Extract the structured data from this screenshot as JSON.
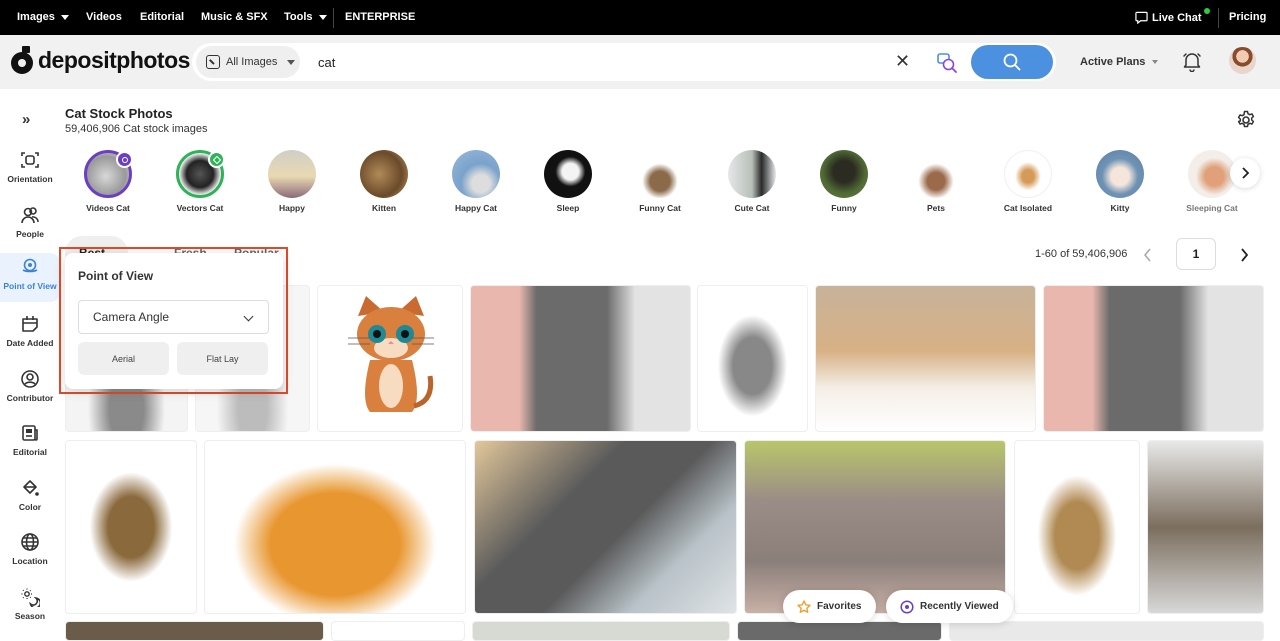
{
  "topbar": {
    "nav": [
      {
        "label": "Images",
        "has_dropdown": true
      },
      {
        "label": "Videos",
        "has_dropdown": false
      },
      {
        "label": "Editorial",
        "has_dropdown": false
      },
      {
        "label": "Music & SFX",
        "has_dropdown": false
      },
      {
        "label": "Tools",
        "has_dropdown": true
      },
      {
        "label": "ENTERPRISE",
        "has_dropdown": false
      }
    ],
    "live_chat": "Live Chat",
    "live_chat_status_color": "#2ecc40",
    "pricing": "Pricing"
  },
  "header": {
    "logo": "depositphotos",
    "search": {
      "type_select": "All Images",
      "query": "cat",
      "placeholder": ""
    },
    "search_button_color": "#4c90e0",
    "active_plans": "Active Plans"
  },
  "sidebar": {
    "toggle": "»",
    "items": [
      {
        "label": "Orientation",
        "icon": "orientation-icon",
        "active": false
      },
      {
        "label": "People",
        "icon": "people-icon",
        "active": false
      },
      {
        "label": "Point of View",
        "icon": "point-of-view-icon",
        "active": true
      },
      {
        "label": "Date Added",
        "icon": "calendar-icon",
        "active": false
      },
      {
        "label": "Contributor",
        "icon": "user-circle-icon",
        "active": false
      },
      {
        "label": "Editorial",
        "icon": "newspaper-icon",
        "active": false
      },
      {
        "label": "Color",
        "icon": "paint-bucket-icon",
        "active": false
      },
      {
        "label": "Location",
        "icon": "globe-icon",
        "active": false
      },
      {
        "label": "Season",
        "icon": "season-icon",
        "active": false
      }
    ]
  },
  "page": {
    "title": "Cat Stock Photos",
    "subtitle": "59,406,906 Cat stock images"
  },
  "categories": [
    {
      "label": "Videos Cat",
      "badge": "camera"
    },
    {
      "label": "Vectors Cat",
      "badge": "pen"
    },
    {
      "label": "Happy"
    },
    {
      "label": "Kitten"
    },
    {
      "label": "Happy Cat"
    },
    {
      "label": "Sleep"
    },
    {
      "label": "Funny Cat"
    },
    {
      "label": "Cute Cat"
    },
    {
      "label": "Funny"
    },
    {
      "label": "Pets"
    },
    {
      "label": "Cat Isolated"
    },
    {
      "label": "Kitty"
    },
    {
      "label": "Sleeping Cat"
    }
  ],
  "sort_tabs": [
    {
      "label": "Best Match",
      "active": true
    },
    {
      "label": "Fresh",
      "active": false
    },
    {
      "label": "Popular",
      "active": false
    }
  ],
  "pagination": {
    "range": "1-60 of 59,406,906",
    "current_page": "1"
  },
  "point_of_view_popup": {
    "title": "Point of View",
    "select_value": "Camera Angle",
    "options": [
      "Aerial",
      "Flat Lay"
    ],
    "highlight_color": "#e04b2a"
  },
  "grid_images": [
    {
      "alt": "Gray cat isolated"
    },
    {
      "alt": "Gray kitten isolated"
    },
    {
      "alt": "Cartoon orange cat"
    },
    {
      "alt": "Woman holding gray Scottish fold cat"
    },
    {
      "alt": "Fluffy tabby cat sitting"
    },
    {
      "alt": "Ginger cat lying on fur rug"
    },
    {
      "alt": "Woman hugging gray cat"
    },
    {
      "alt": "Tabby cat standing on hind legs"
    },
    {
      "alt": "Orange cat portrait"
    },
    {
      "alt": "Gray cat in yellow blanket"
    },
    {
      "alt": "Gray tabby cat lying"
    },
    {
      "alt": "Bengal cat sitting"
    },
    {
      "alt": "Tabby cat lying"
    }
  ],
  "floating": {
    "favorites": "Favorites",
    "recently_viewed": "Recently Viewed"
  }
}
